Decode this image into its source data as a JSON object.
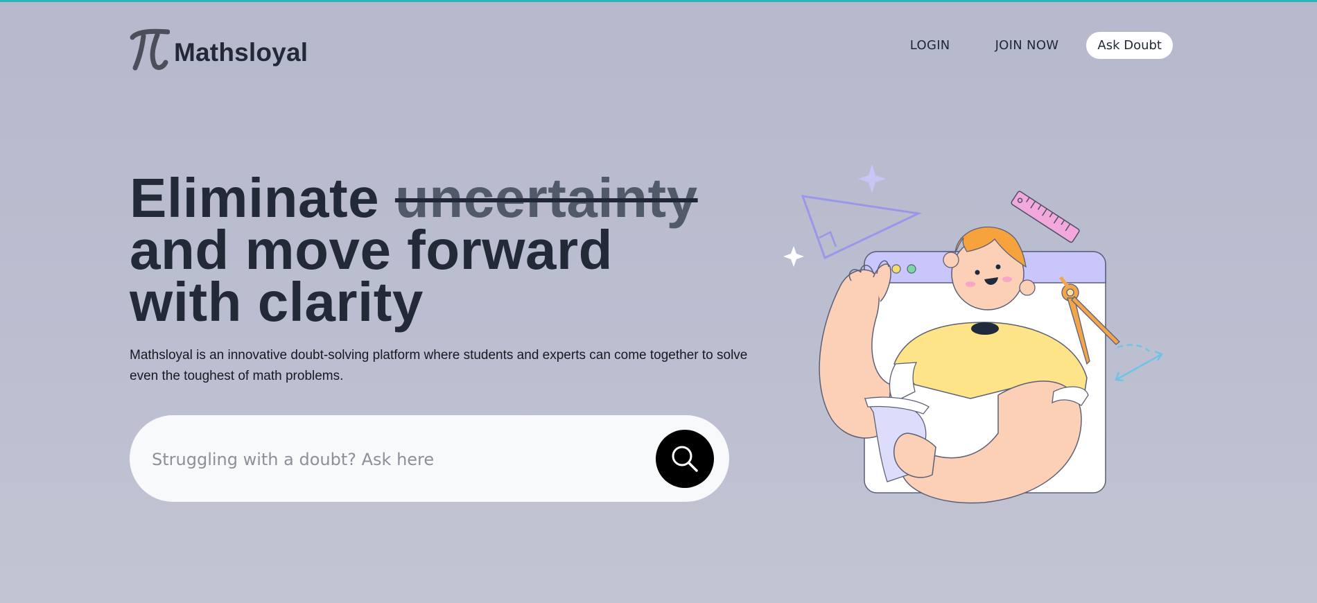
{
  "brand": {
    "name": "Mathsloyal",
    "accent_color": "#2bb5b8",
    "logo_icon": "pi-icon"
  },
  "nav": {
    "login_label": "LOGIN",
    "join_label": "JOIN NOW",
    "ask_label": "Ask Doubt"
  },
  "hero": {
    "headline_word1": "Eliminate",
    "headline_struck": "uncertainty",
    "headline_line2": "and move forward",
    "headline_line3": "with clarity",
    "description": "Mathsloyal is an innovative doubt-solving platform where students and experts can come together to solve even the toughest of math problems."
  },
  "search": {
    "placeholder": "Struggling with a doubt? Ask here",
    "button_icon": "search-icon"
  },
  "illustration": {
    "name": "student-with-math-tools-illustration"
  }
}
